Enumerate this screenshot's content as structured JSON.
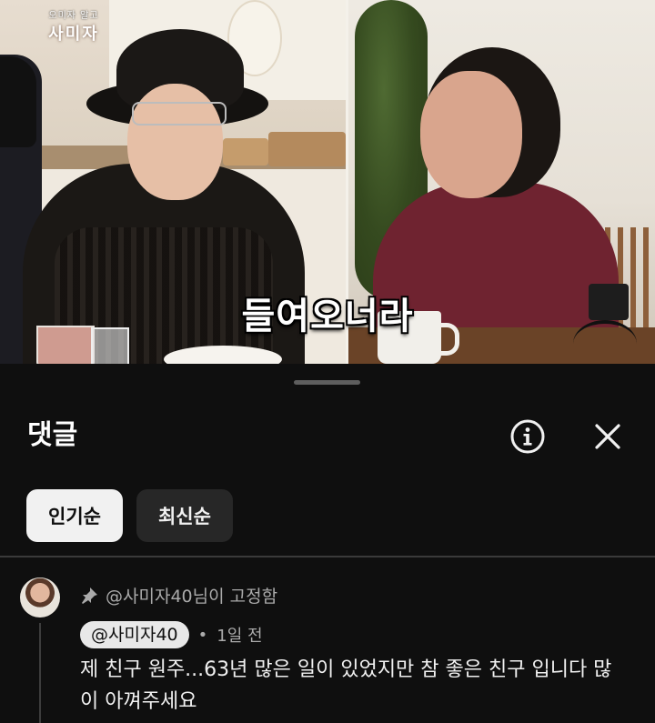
{
  "video": {
    "logo_small": "오미자 알고",
    "logo_main": "사미자",
    "subtitle": "들여오너라"
  },
  "comments_panel": {
    "title": "댓글",
    "info_icon": "info-icon",
    "close_icon": "close-icon",
    "sort_chips": [
      {
        "label": "인기순",
        "active": true
      },
      {
        "label": "최신순",
        "active": false
      }
    ],
    "pinned_comment": {
      "pin_icon": "pin-icon",
      "pinned_label": "@사미자40님이 고정함",
      "author": "@사미자40",
      "time": "1일 전",
      "text": "제 친구 원주...63년 많은 일이 있었지만 참 좋은 친구 입니다 많이 아껴주세요"
    }
  },
  "colors": {
    "background": "#0f0f0f",
    "chip_active": "#f1f1f1",
    "chip_inactive": "#272727",
    "secondary_text": "#aaaaaa"
  }
}
